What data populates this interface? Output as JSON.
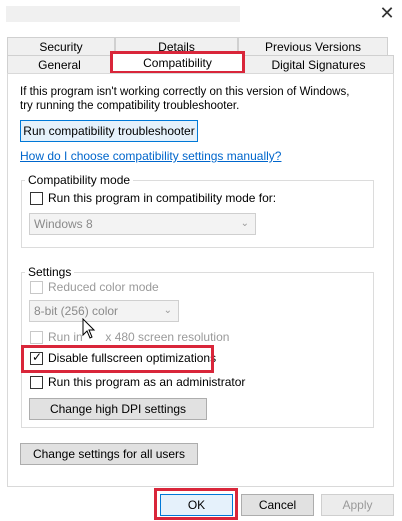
{
  "window": {
    "close_symbol": "✕"
  },
  "tabs": {
    "row1": [
      "Security",
      "Details",
      "Previous Versions"
    ],
    "row2": [
      "General",
      "Compatibility",
      "Digital Signatures"
    ],
    "active": "Compatibility"
  },
  "intro": {
    "line1": "If this program isn't working correctly on this version of Windows,",
    "line2": "try running the compatibility troubleshooter."
  },
  "troubleshooter_button": "Run compatibility troubleshooter",
  "manual_link": "How do I choose compatibility settings manually?",
  "compat_mode": {
    "label": "Compatibility mode",
    "checkbox": "Run this program in compatibility mode for:",
    "selected_os": "Windows 8"
  },
  "settings": {
    "label": "Settings",
    "reduced_color": "Reduced color mode",
    "color_depth": "8-bit (256) color",
    "low_res_prefix": "Run in ",
    "low_res_suffix": " x 480 screen resolution",
    "disable_fullscreen": "Disable fullscreen optimizations",
    "run_as_admin": "Run this program as an administrator",
    "high_dpi_button": "Change high DPI settings"
  },
  "all_users_button": "Change settings for all users",
  "footer": {
    "ok": "OK",
    "cancel": "Cancel",
    "apply": "Apply"
  },
  "highlight_color": "#d9263a"
}
